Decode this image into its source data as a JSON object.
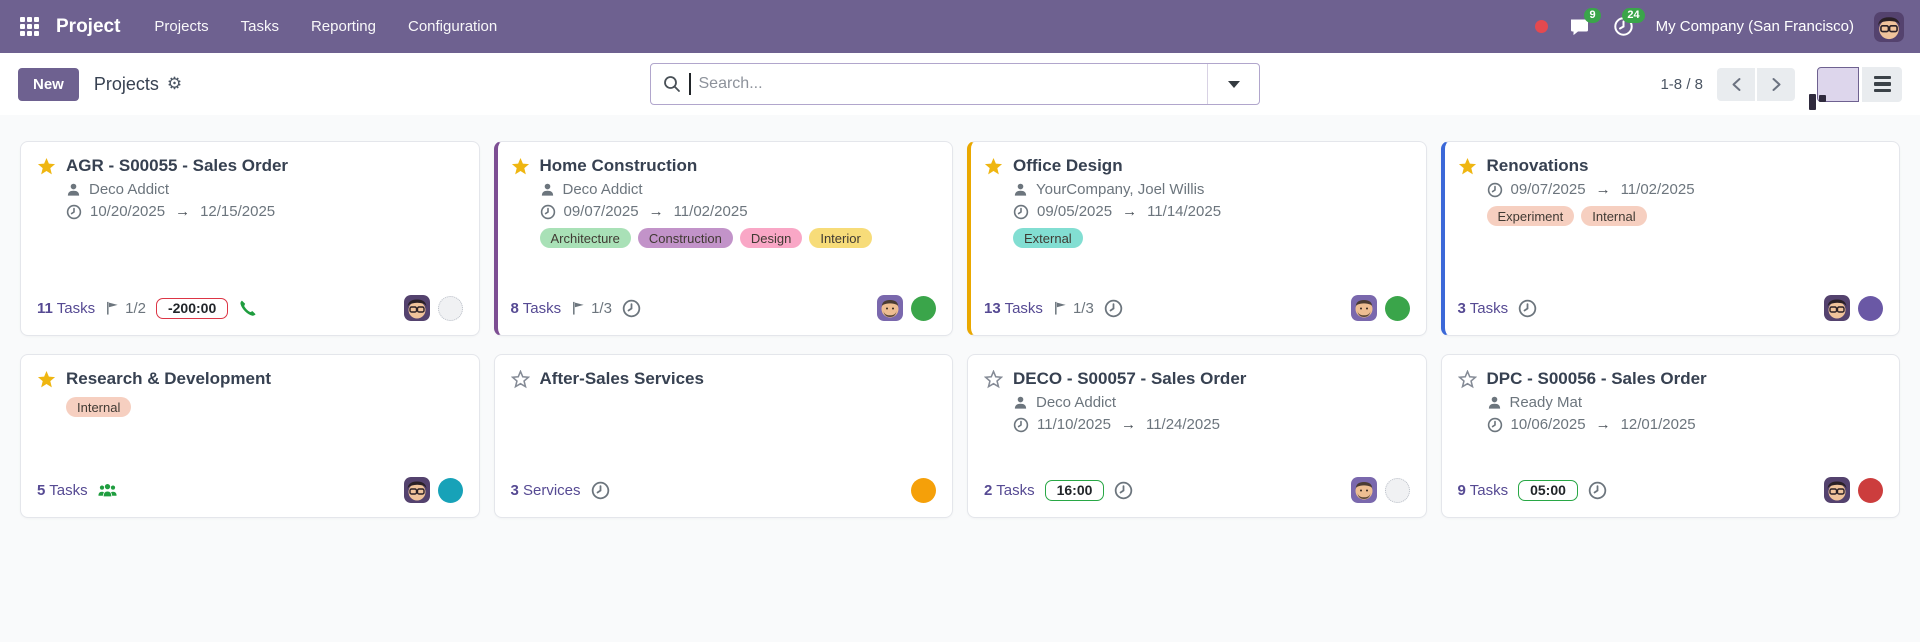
{
  "navbar": {
    "app_name": "Project",
    "menu": [
      "Projects",
      "Tasks",
      "Reporting",
      "Configuration"
    ],
    "status_dot_color": "#e5494f",
    "messages_badge": "9",
    "activities_badge": "24",
    "badge_color": "#3aa54a",
    "company_name": "My Company (San Francisco)"
  },
  "control_panel": {
    "new_button_label": "New",
    "title": "Projects",
    "search_placeholder": "Search...",
    "pager_text": "1-8 / 8"
  },
  "cards": [
    {
      "title": "AGR - S00055 - Sales Order",
      "starred": true,
      "accent": null,
      "customer": "Deco Addict",
      "date_start": "10/20/2025",
      "date_end": "12/15/2025",
      "tags": [],
      "count": "11",
      "count_label": "Tasks",
      "flag": "1/2",
      "pill": {
        "text": "-200:00",
        "border": "#dc3545"
      },
      "icons": [
        "phone"
      ],
      "avatar": "glasses",
      "status": {
        "color": "#f0f1f3",
        "muted": true
      }
    },
    {
      "title": "Home Construction",
      "starred": true,
      "accent": "#7d4e93",
      "customer": "Deco Addict",
      "date_start": "09/07/2025",
      "date_end": "11/02/2025",
      "tags": [
        {
          "label": "Architecture",
          "bg": "#a9e1b7"
        },
        {
          "label": "Construction",
          "bg": "#c293c9"
        },
        {
          "label": "Design",
          "bg": "#f9a7c6"
        },
        {
          "label": "Interior",
          "bg": "#f7dc79"
        }
      ],
      "count": "8",
      "count_label": "Tasks",
      "flag": "1/3",
      "pill": null,
      "icons": [
        "clock"
      ],
      "avatar": "beard",
      "status": {
        "color": "#3aa54a",
        "muted": false
      }
    },
    {
      "title": "Office Design",
      "starred": true,
      "accent": "#eaa800",
      "customer": "YourCompany, Joel Willis",
      "date_start": "09/05/2025",
      "date_end": "11/14/2025",
      "tags": [
        {
          "label": "External",
          "bg": "#82ded2"
        }
      ],
      "count": "13",
      "count_label": "Tasks",
      "flag": "1/3",
      "pill": null,
      "icons": [
        "clock"
      ],
      "avatar": "beard",
      "status": {
        "color": "#3aa54a",
        "muted": false
      }
    },
    {
      "title": "Renovations",
      "starred": true,
      "accent": "#3b68d8",
      "customer": null,
      "date_start": "09/07/2025",
      "date_end": "11/02/2025",
      "tags": [
        {
          "label": "Experiment",
          "bg": "#f6cfc0"
        },
        {
          "label": "Internal",
          "bg": "#f6cfc0"
        }
      ],
      "count": "3",
      "count_label": "Tasks",
      "flag": null,
      "pill": null,
      "icons": [
        "clock"
      ],
      "avatar": "glasses",
      "status": {
        "color": "#6a58a5",
        "muted": false
      }
    },
    {
      "title": "Research & Development",
      "starred": true,
      "accent": null,
      "customer": null,
      "date_start": null,
      "date_end": null,
      "tags": [
        {
          "label": "Internal",
          "bg": "#f6cfc0"
        }
      ],
      "count": "5",
      "count_label": "Tasks",
      "flag": null,
      "pill": null,
      "icons": [
        "group"
      ],
      "avatar": "glasses",
      "status": {
        "color": "#17a2b8",
        "muted": false
      }
    },
    {
      "title": "After-Sales Services",
      "starred": false,
      "accent": null,
      "customer": null,
      "date_start": null,
      "date_end": null,
      "tags": [],
      "count": "3",
      "count_label": "Services",
      "flag": null,
      "pill": null,
      "icons": [
        "clock"
      ],
      "avatar": null,
      "status": {
        "color": "#f5a009",
        "muted": false
      }
    },
    {
      "title": "DECO - S00057 - Sales Order",
      "starred": false,
      "accent": null,
      "customer": "Deco Addict",
      "date_start": "11/10/2025",
      "date_end": "11/24/2025",
      "tags": [],
      "count": "2",
      "count_label": "Tasks",
      "flag": null,
      "pill": {
        "text": "16:00",
        "border": "#28a745"
      },
      "icons": [
        "clock"
      ],
      "avatar": "beard",
      "status": {
        "color": "#f0f1f3",
        "muted": true
      }
    },
    {
      "title": "DPC - S00056 - Sales Order",
      "starred": false,
      "accent": null,
      "customer": "Ready Mat",
      "date_start": "10/06/2025",
      "date_end": "12/01/2025",
      "tags": [],
      "count": "9",
      "count_label": "Tasks",
      "flag": null,
      "pill": {
        "text": "05:00",
        "border": "#28a745"
      },
      "icons": [
        "clock"
      ],
      "avatar": "glasses",
      "status": {
        "color": "#cc3d3d",
        "muted": false
      }
    }
  ]
}
